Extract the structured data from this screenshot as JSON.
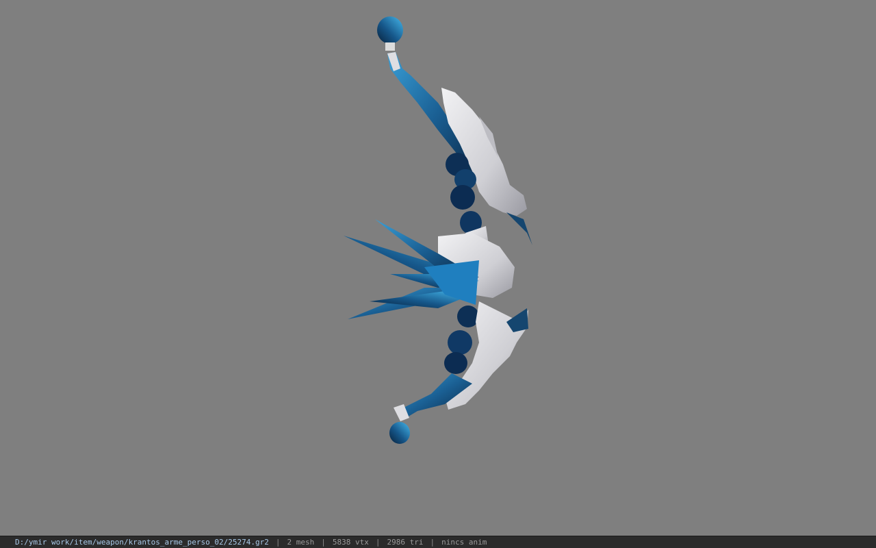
{
  "status_bar": {
    "file_path": "D:/ymir work/item/weapon/krantos_arme_perso_02/25274.gr2",
    "separator": "|",
    "mesh_count": "2 mesh",
    "vertex_count": "5838 vtx",
    "triangle_count": "2986 tri",
    "animation_status": "nincs anim"
  },
  "colors": {
    "viewport_background": "#7f7f7f",
    "status_background": "#2b2b2b",
    "crystal_blue": "#1d6fa8",
    "crystal_dark": "#0d2a4a",
    "silver": "#d9d9dc"
  }
}
